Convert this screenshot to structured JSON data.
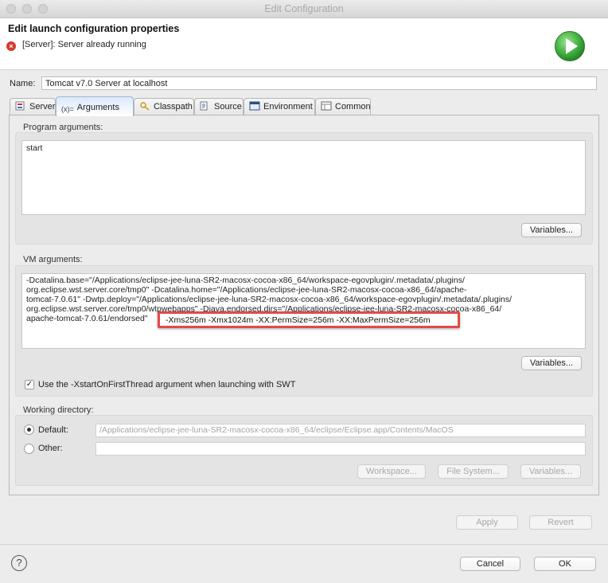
{
  "window": {
    "title": "Edit Configuration"
  },
  "header": {
    "title": "Edit launch configuration properties",
    "message": "[Server]: Server already running",
    "accent": "#3fae3f"
  },
  "name": {
    "label": "Name:",
    "value": "Tomcat v7.0 Server at localhost"
  },
  "tabs": [
    {
      "label": "Server",
      "icon": "server-icon"
    },
    {
      "label": "Arguments",
      "icon": "arguments-icon",
      "active": true
    },
    {
      "label": "Classpath",
      "icon": "classpath-icon"
    },
    {
      "label": "Source",
      "icon": "source-icon"
    },
    {
      "label": "Environment",
      "icon": "environment-icon"
    },
    {
      "label": "Common",
      "icon": "common-icon"
    }
  ],
  "program_args": {
    "label": "Program arguments:",
    "value": "start",
    "variables_button": "Variables..."
  },
  "vm_args": {
    "label": "VM arguments:",
    "lines": [
      "-Dcatalina.base=\"/Applications/eclipse-jee-luna-SR2-macosx-cocoa-x86_64/workspace-egovplugin/.metadata/.plugins/",
      "org.eclipse.wst.server.core/tmp0\" -Dcatalina.home=\"/Applications/eclipse-jee-luna-SR2-macosx-cocoa-x86_64/apache-",
      "tomcat-7.0.61\" -Dwtp.deploy=\"/Applications/eclipse-jee-luna-SR2-macosx-cocoa-x86_64/workspace-egovplugin/.metadata/.plugins/",
      "org.eclipse.wst.server.core/tmp0/wtpwebapps\" -Djava.endorsed.dirs=\"/Applications/eclipse-jee-luna-SR2-macosx-cocoa-x86_64/",
      "apache-tomcat-7.0.61/endorsed\""
    ],
    "highlighted": "-Xms256m -Xmx1024m -XX:PermSize=256m -XX:MaxPermSize=256m",
    "variables_button": "Variables..."
  },
  "swt_option": {
    "label": "Use the -XstartOnFirstThread argument when launching with SWT",
    "checked": true
  },
  "working_dir": {
    "label": "Working directory:",
    "default_label": "Default:",
    "default_value": "/Applications/eclipse-jee-luna-SR2-macosx-cocoa-x86_64/eclipse/Eclipse.app/Contents/MacOS",
    "other_label": "Other:",
    "other_value": "",
    "workspace_button": "Workspace...",
    "filesystem_button": "File System...",
    "variables_button": "Variables..."
  },
  "actions": {
    "apply": "Apply",
    "revert": "Revert"
  },
  "footer": {
    "help": "?",
    "cancel": "Cancel",
    "ok": "OK"
  }
}
